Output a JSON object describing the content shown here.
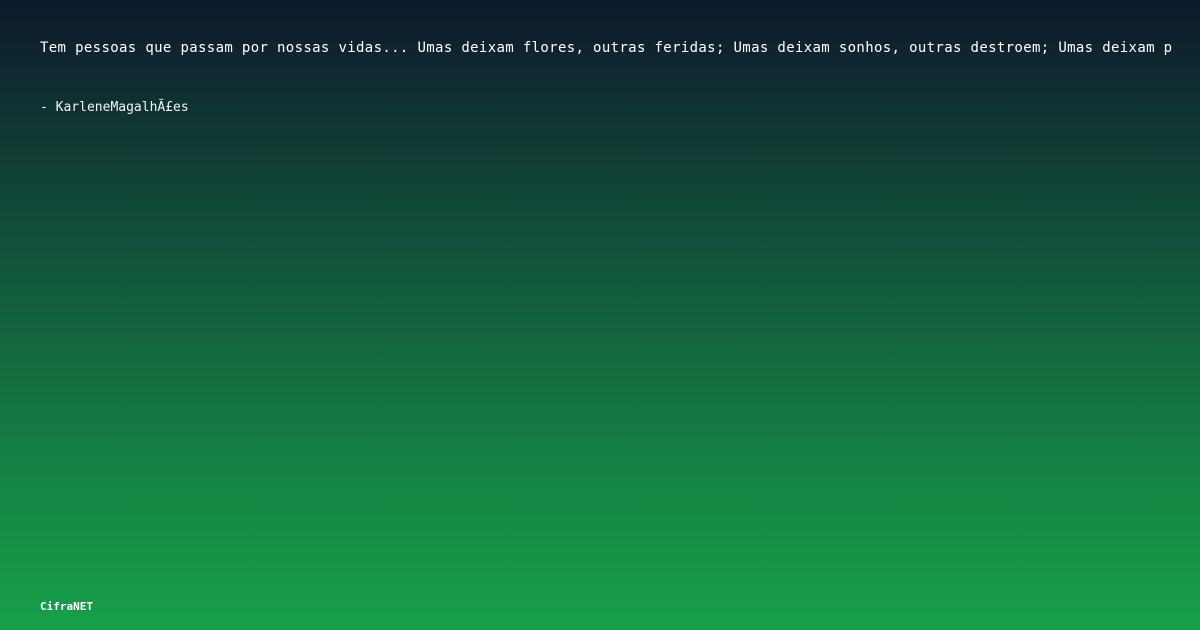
{
  "quote": {
    "text": "Tem pessoas que passam por nossas vidas... Umas deixam flores, outras feridas; Umas deixam sonhos, outras destroem; Umas deixam p",
    "author": "- KarleneMagalhÃ£es"
  },
  "footer": {
    "brand": "CifraNET"
  }
}
